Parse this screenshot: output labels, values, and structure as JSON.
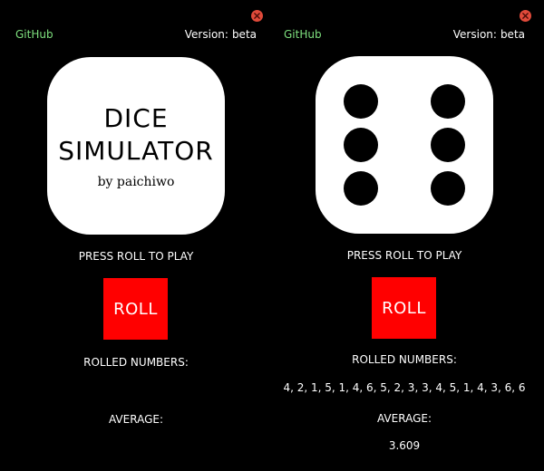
{
  "left": {
    "github_label": "GitHub",
    "version_label": "Version:",
    "version_value": "beta",
    "title_line1": "DICE",
    "title_line2": "SIMULATOR",
    "byline": "by paichiwo",
    "prompt": "PRESS ROLL TO PLAY",
    "roll_label": "ROLL",
    "rolled_label": "ROLLED NUMBERS:",
    "average_label": "AVERAGE:"
  },
  "right": {
    "github_label": "GitHub",
    "version_label": "Version:",
    "version_value": "beta",
    "die_face": 6,
    "prompt": "PRESS ROLL TO PLAY",
    "roll_label": "ROLL",
    "rolled_label": "ROLLED NUMBERS:",
    "rolled_values": "4, 2, 1, 5, 1, 4, 6, 5, 2, 3, 3, 4, 5, 1, 4, 3, 6, 6",
    "average_label": "AVERAGE:",
    "average_value": "3.609"
  },
  "colors": {
    "background": "#000000",
    "roll_button": "#ff0000",
    "github_link": "#7ee07e",
    "close_button": "#e04a3a",
    "die": "#ffffff"
  },
  "icons": {
    "close": "close-x-icon"
  }
}
